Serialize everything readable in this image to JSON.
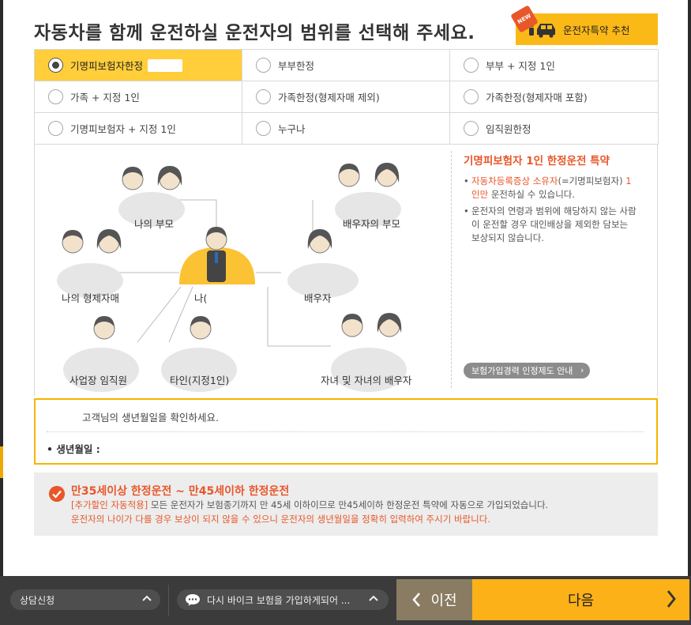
{
  "header": {
    "title": "자동차를 함께 운전하실 운전자의 범위를 선택해 주세요.",
    "recommend_label": "운전자특약 추천",
    "new_badge": "NEW"
  },
  "options": [
    {
      "label": "기명피보험자한정",
      "selected": true
    },
    {
      "label": "부부한정",
      "selected": false
    },
    {
      "label": "부부 + 지정 1인",
      "selected": false
    },
    {
      "label": "가족 + 지정 1인",
      "selected": false
    },
    {
      "label": "가족한정(형제자매 제외)",
      "selected": false
    },
    {
      "label": "가족한정(형제자매 포함)",
      "selected": false
    },
    {
      "label": "기명피보험자 + 지정 1인",
      "selected": false
    },
    {
      "label": "누구나",
      "selected": false
    },
    {
      "label": "임직원한정",
      "selected": false
    }
  ],
  "diagram": {
    "labels": {
      "my_parents": "나의 부모",
      "spouse_parents": "배우자의 부모",
      "my_siblings": "나의 형제자매",
      "me": "나(",
      "spouse": "배우자",
      "employee": "사업장 임직원",
      "other": "타인(지정1인)",
      "children": "자녀 및 자녀의 배우자"
    }
  },
  "info": {
    "title": "기명피보험자 1인 한정운전 특약",
    "item1_hl": "자동차등록증상 소유자",
    "item1_mid": "(=기명피보험자) ",
    "item1_hl2": "1인만",
    "item1_rest": " 운전하실 수 있습니다.",
    "item2": "운전자의 연령과 범위에 해당하지 않는 사람이 운전할 경우 대인배상을 제외한 담보는 보상되지 않습니다.",
    "guide_button": "보험가입경력 인정제도 안내"
  },
  "birth": {
    "prompt": "고객님의 생년월일을 확인하세요.",
    "label": "• 생년월일 :"
  },
  "notice": {
    "title": "만35세이상 한정운전 ~ 만45세이하 한정운전",
    "line1_red": "[추가할인 자동적용]",
    "line1_rest": " 모든 운전자가 보험종기까지 만 45세 이하이므로 만45세이하 한정운전 특약에 자동으로 가입되었습니다.",
    "line2": "운전자의 나이가 다를 경우 보상이 되지 않을 수 있으니 운전자의 생년월일을 정확히 입력하여 주시기 바랍니다."
  },
  "footer": {
    "consult_label": "상담신청",
    "chat_text": "다시 바이크 보험을 가입하게되어 ...",
    "prev_label": "이전",
    "next_label": "다음"
  },
  "colors": {
    "accent": "#fbb117",
    "selected_option": "#ffce3a",
    "highlight_red": "#e8572a"
  }
}
